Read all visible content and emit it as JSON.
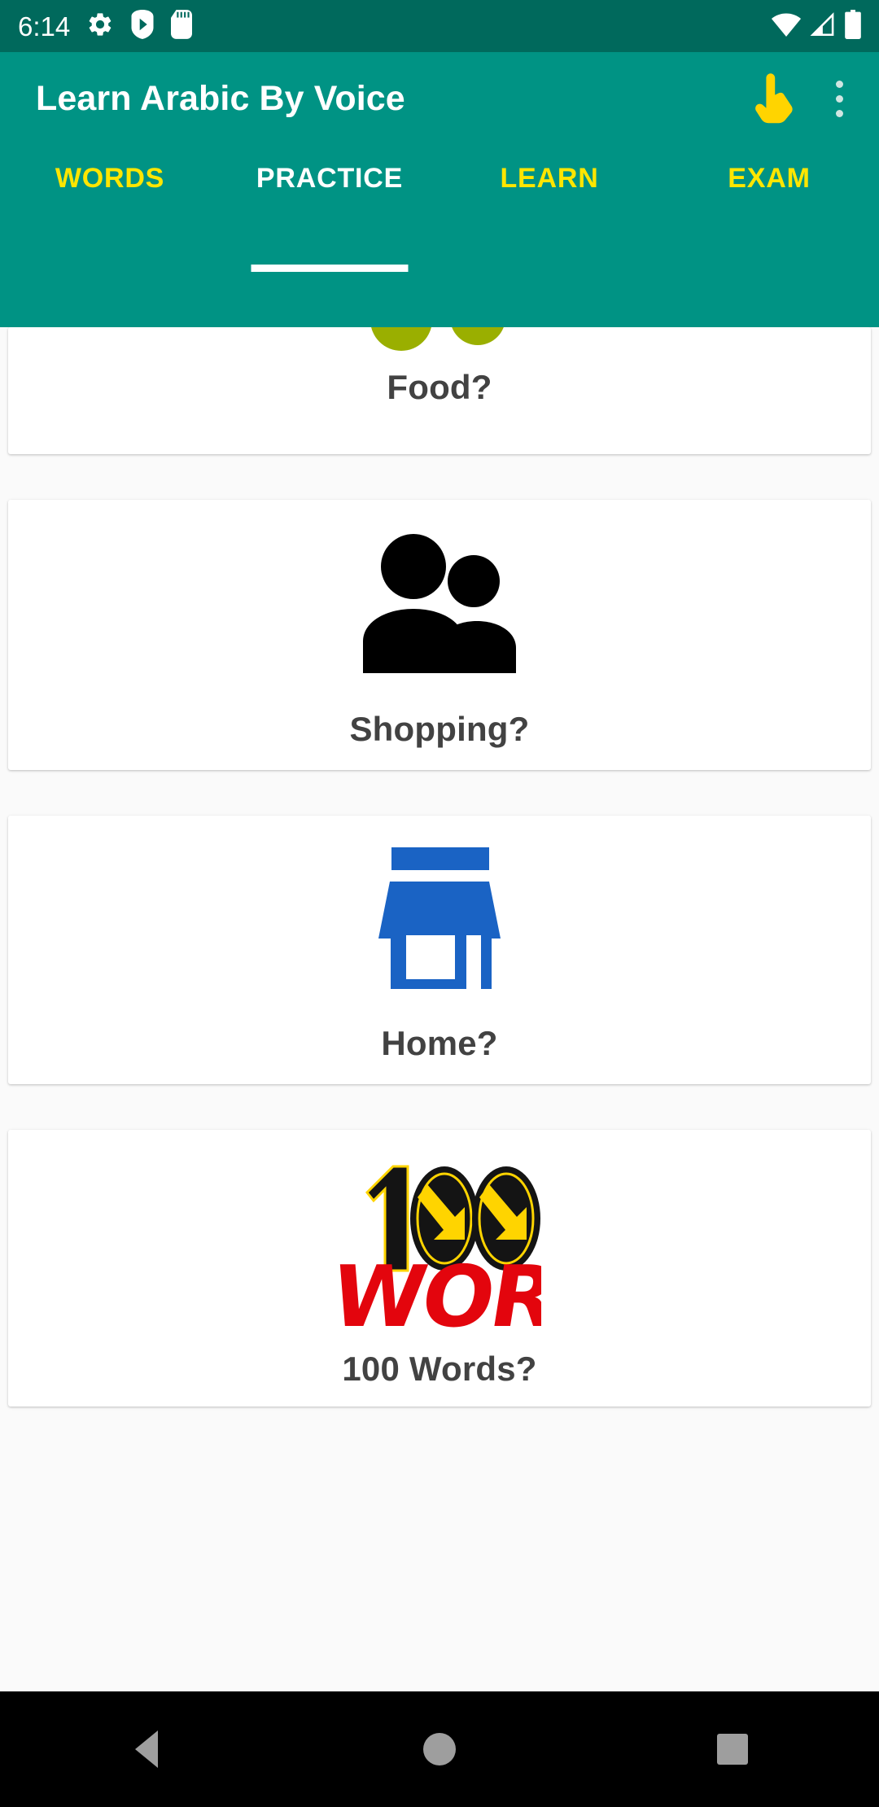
{
  "status_bar": {
    "time": "6:14",
    "left_icons": [
      "settings-gear-icon",
      "play-store-icon",
      "sd-card-icon"
    ],
    "right_icons": [
      "wifi-icon",
      "cellular-signal-icon",
      "battery-icon"
    ],
    "background_color": "#00695c"
  },
  "app_bar": {
    "title": "Learn Arabic By Voice",
    "background_color": "#009384",
    "actions": [
      {
        "name": "touch-hand-icon",
        "color": "#ffd400"
      },
      {
        "name": "overflow-menu-icon",
        "color": "#cfe6e2"
      }
    ]
  },
  "tabs": {
    "active_index": 1,
    "active_color": "#ffffff",
    "inactive_color": "#ffe600",
    "items": [
      {
        "label": "WORDS"
      },
      {
        "label": "PRACTICE"
      },
      {
        "label": "LEARN"
      },
      {
        "label": "EXAM"
      }
    ]
  },
  "cards": [
    {
      "label": "Food?",
      "icon": "two-green-circles-icon",
      "icon_color": "#8aaf00",
      "partially_visible": true
    },
    {
      "label": "Shopping?",
      "icon": "two-people-icon",
      "icon_color": "#000000",
      "partially_visible": false
    },
    {
      "label": "Home?",
      "icon": "store-front-icon",
      "icon_color": "#1a63c4",
      "partially_visible": false
    },
    {
      "label": "100 Words?",
      "icon": "hundred-word-logo-icon",
      "logo": {
        "number": "100",
        "word": "WORD",
        "number_color": "#141414",
        "number_outline_color": "#ffd400",
        "arrow_color": "#ffd400",
        "word_color": "#e3050d"
      },
      "partially_visible": false
    }
  ],
  "nav_bar": {
    "background_color": "#000000",
    "buttons": [
      {
        "name": "back-button",
        "icon": "triangle-back-icon"
      },
      {
        "name": "home-button",
        "icon": "circle-home-icon"
      },
      {
        "name": "recents-button",
        "icon": "square-recents-icon"
      }
    ]
  }
}
